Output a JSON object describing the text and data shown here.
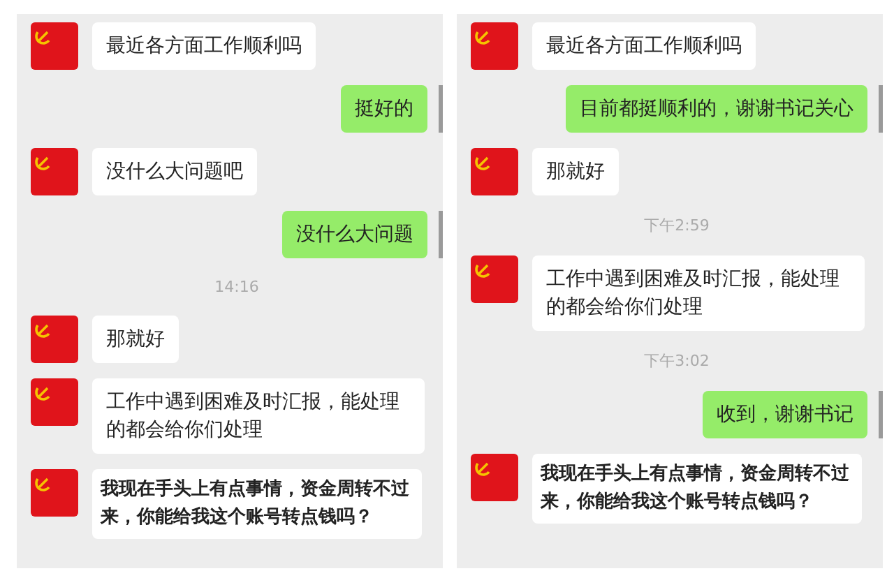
{
  "panels": [
    {
      "messages": [
        {
          "kind": "incoming",
          "text": "最近各方面工作顺利吗",
          "bold": false
        },
        {
          "kind": "outgoing",
          "text": "挺好的",
          "bold": false
        },
        {
          "kind": "incoming",
          "text": "没什么大问题吧",
          "bold": false
        },
        {
          "kind": "outgoing",
          "text": "没什么大问题",
          "bold": false
        },
        {
          "kind": "time",
          "text": "14:16"
        },
        {
          "kind": "incoming",
          "text": "那就好",
          "bold": false
        },
        {
          "kind": "incoming",
          "text": "工作中遇到困难及时汇报，能处理的都会给你们处理",
          "bold": false
        },
        {
          "kind": "incoming",
          "text": "我现在手头上有点事情，资金周转不过来，你能给我这个账号转点钱吗？",
          "bold": true
        }
      ]
    },
    {
      "messages": [
        {
          "kind": "incoming",
          "text": "最近各方面工作顺利吗",
          "bold": false
        },
        {
          "kind": "outgoing",
          "text": "目前都挺顺利的，谢谢书记关心",
          "bold": false
        },
        {
          "kind": "incoming",
          "text": "那就好",
          "bold": false
        },
        {
          "kind": "time",
          "text": "下午2:59"
        },
        {
          "kind": "incoming",
          "text": "工作中遇到困难及时汇报，能处理的都会给你们处理",
          "bold": false
        },
        {
          "kind": "time",
          "text": "下午3:02"
        },
        {
          "kind": "outgoing",
          "text": "收到，谢谢书记",
          "bold": false
        },
        {
          "kind": "incoming",
          "text": "我现在手头上有点事情，资金周转不过来，你能给我这个账号转点钱吗？",
          "bold": true
        }
      ]
    }
  ]
}
